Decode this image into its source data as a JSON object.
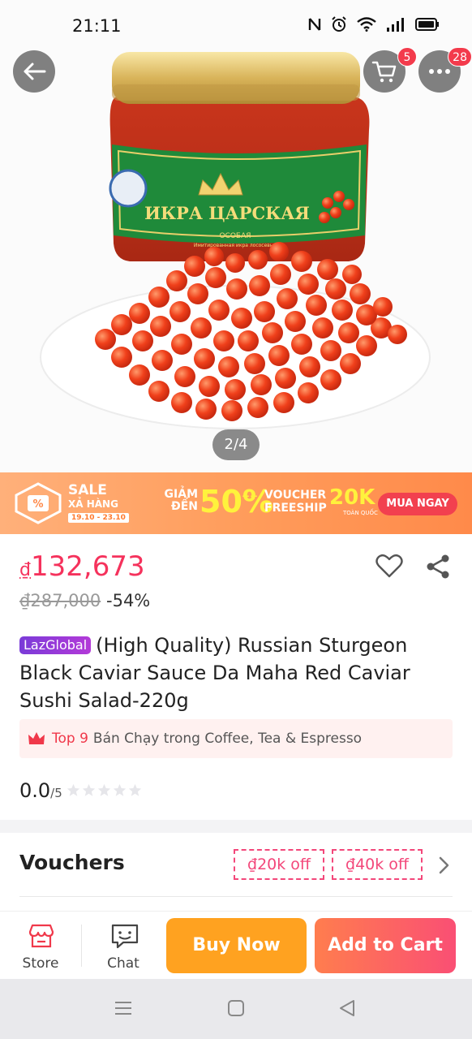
{
  "status_bar": {
    "time": "21:11"
  },
  "hero": {
    "image_counter": "2/4",
    "cart_badge": "5",
    "more_badge": "28",
    "jar_label": "ИКРА ЦАРСКАЯ",
    "jar_sub": "ОСОБАЯ",
    "jar_fine": "Имитированная икра лососевых"
  },
  "banner": {
    "sale_title": "SALE",
    "sale_sub": "XẢ HÀNG",
    "sale_date": "19.10 - 23.10",
    "giam_line1": "GIẢM",
    "giam_line2": "ĐẾN",
    "percent": "50%",
    "plus": "++",
    "voucher_line1": "VOUCHER",
    "voucher_line2": "FREESHIP",
    "voucher_amount": "20K",
    "voucher_scope": "TOÀN QUỐC",
    "cta": "MUA NGAY"
  },
  "product": {
    "currency": "₫",
    "price": "132,673",
    "old_price": "₫287,000",
    "discount": "-54%",
    "laz_badge": "LazGlobal",
    "title": "(High Quality) Russian Sturgeon Black Caviar Sauce Da Maha Red Caviar Sushi Salad-220g",
    "top_rank": "Top 9",
    "top_category": "Bán Chạy trong Coffee, Tea & Espresso",
    "rating": "0.0",
    "rating_max": "/5",
    "stars_filled": 0,
    "stars_total": 5
  },
  "vouchers": {
    "label": "Vouchers",
    "chips": [
      "₫20k off",
      "₫40k off"
    ]
  },
  "actions": {
    "store": "Store",
    "chat": "Chat",
    "buy_now": "Buy Now",
    "add_to_cart": "Add to Cart"
  },
  "colors": {
    "price": "#f5325c",
    "buy_now": "#ffa220",
    "add_to_cart_start": "#ff7d4e",
    "add_to_cart_end": "#fa4f74",
    "badge": "#f33b4c"
  },
  "icons": [
    "back-arrow-icon",
    "cart-icon",
    "more-icon",
    "heart-icon",
    "share-icon",
    "crown-icon",
    "star-icon",
    "chevron-right-icon",
    "store-icon",
    "chat-icon",
    "menu-icon",
    "home-square-icon",
    "back-triangle-icon"
  ]
}
